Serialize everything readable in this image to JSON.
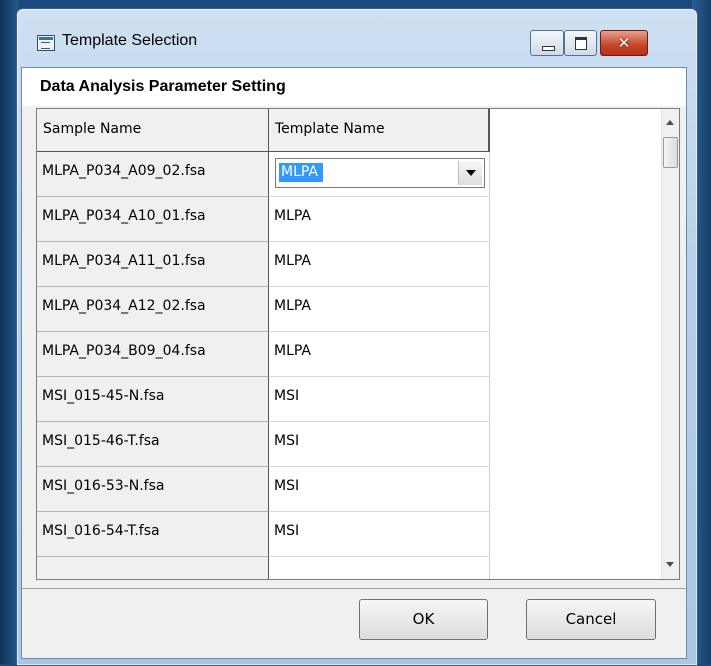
{
  "window": {
    "title": "Template Selection",
    "close_glyph": "✕",
    "controls": [
      "minimize",
      "maximize",
      "close"
    ]
  },
  "group_title": "Data Analysis Parameter Setting",
  "table": {
    "columns": [
      "Sample Name",
      "Template Name"
    ],
    "rows": [
      {
        "sample": "MLPA_P034_A09_02.fsa",
        "template": "MLPA"
      },
      {
        "sample": "MLPA_P034_A10_01.fsa",
        "template": "MLPA"
      },
      {
        "sample": "MLPA_P034_A11_01.fsa",
        "template": "MLPA"
      },
      {
        "sample": "MLPA_P034_A12_02.fsa",
        "template": "MLPA"
      },
      {
        "sample": "MLPA_P034_B09_04.fsa",
        "template": "MLPA"
      },
      {
        "sample": "MSI_015-45-N.fsa",
        "template": "MSI"
      },
      {
        "sample": "MSI_015-46-T.fsa",
        "template": "MSI"
      },
      {
        "sample": "MSI_016-53-N.fsa",
        "template": "MSI"
      },
      {
        "sample": "MSI_016-54-T.fsa",
        "template": "MSI"
      }
    ],
    "editing_combo": {
      "value": "MLPA"
    }
  },
  "buttons": {
    "ok": "OK",
    "cancel": "Cancel"
  },
  "colors": {
    "selection": "#3399ff",
    "close_button": "#c74a31"
  }
}
